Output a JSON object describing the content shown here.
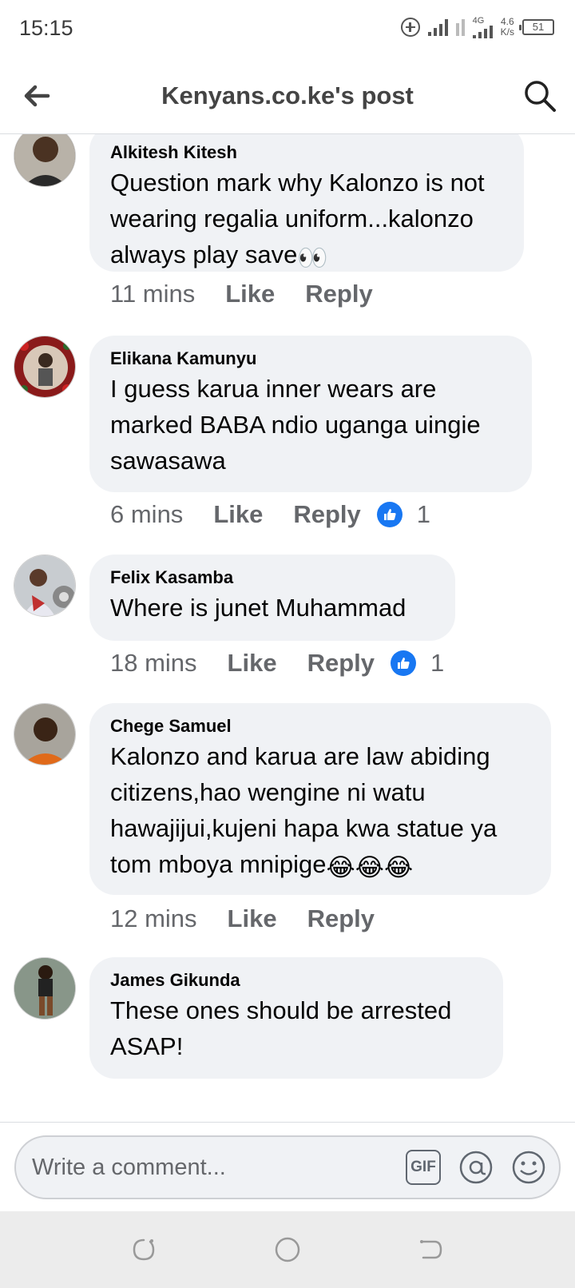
{
  "status": {
    "time": "15:15",
    "network": "4G",
    "speed_value": "4.6",
    "speed_unit": "K/s",
    "battery": "51"
  },
  "header": {
    "title": "Kenyans.co.ke's post"
  },
  "comments": [
    {
      "author": "Alkitesh Kitesh",
      "text": "Question mark why Kalonzo is not wearing regalia uniform...kalonzo always play save",
      "emoji": "👀",
      "time": "11 mins",
      "like": "Like",
      "reply": "Reply",
      "reactions": ""
    },
    {
      "author": "Elikana Kamunyu",
      "text": "I guess karua inner wears are marked BABA ndio uganga uingie sawasawa",
      "emoji": "",
      "time": "6 mins",
      "like": "Like",
      "reply": "Reply",
      "reactions": "1"
    },
    {
      "author": "Felix Kasamba",
      "text": "Where is junet Muhammad",
      "emoji": "",
      "time": "18 mins",
      "like": "Like",
      "reply": "Reply",
      "reactions": "1"
    },
    {
      "author": "Chege Samuel",
      "text": "Kalonzo and karua are  law abiding citizens,hao wengine ni watu hawajijui,kujeni hapa kwa statue ya tom mboya mnipige",
      "emoji": "😂😂😂",
      "time": "12 mins",
      "like": "Like",
      "reply": "Reply",
      "reactions": ""
    },
    {
      "author": "James Gikunda",
      "text": "These ones should be arrested ASAP!",
      "emoji": "",
      "time": "",
      "like": "",
      "reply": "",
      "reactions": ""
    }
  ],
  "composer": {
    "placeholder": "Write a comment...",
    "gif_label": "GIF"
  },
  "colors": {
    "bubble": "#f0f2f5",
    "like_blue": "#1877f2",
    "meta_gray": "#65676b"
  }
}
